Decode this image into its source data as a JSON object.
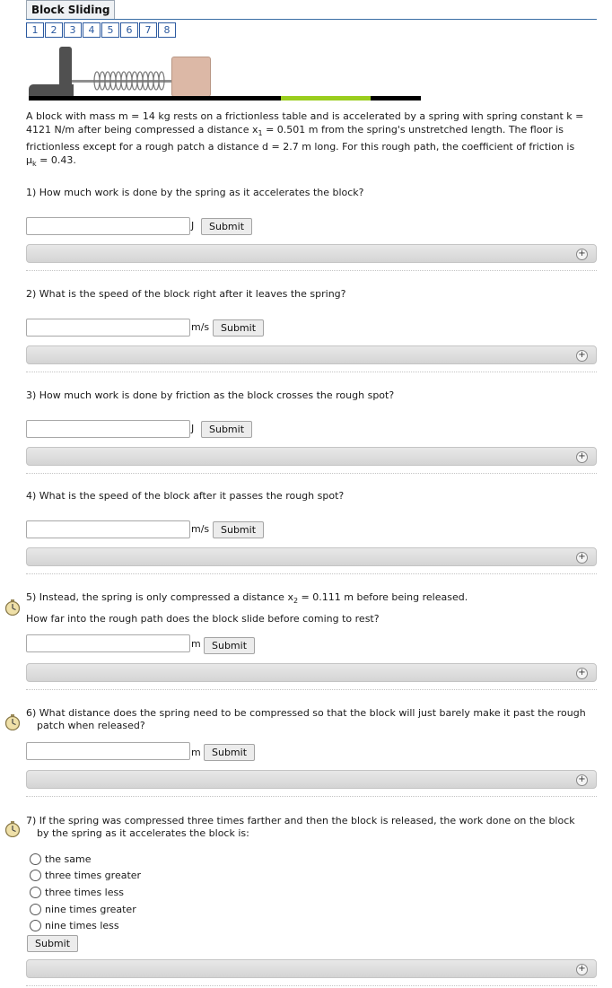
{
  "title": "Block Sliding",
  "pages": [
    "1",
    "2",
    "3",
    "4",
    "5",
    "6",
    "7",
    "8"
  ],
  "problem": {
    "line1": "A block with mass m = 14 kg rests on a frictionless table and is accelerated by a spring with spring constant k =",
    "line2_pre": "4121 N/m after being compressed a distance x",
    "line2_sub": "1",
    "line2_post": " = 0.501 m from the spring's unstretched length. The floor is",
    "line3": "frictionless except for a rough patch a distance d = 2.7 m long. For this rough path, the coefficient of friction is",
    "line4_pre": "μ",
    "line4_sub": "k",
    "line4_post": " = 0.43."
  },
  "questions": [
    {
      "text": "1) How much work is done by the spring as it accelerates the block?",
      "unit": "J",
      "submit": "Submit"
    },
    {
      "text": "2) What is the speed of the block right after it leaves the spring?",
      "unit": "m/s",
      "submit": "Submit"
    },
    {
      "text": "3) How much work is done by friction as the block crosses the rough spot?",
      "unit": "J",
      "submit": "Submit"
    },
    {
      "text": "4) What is the speed of the block after it passes the rough spot?",
      "unit": "m/s",
      "submit": "Submit"
    },
    {
      "text_pre": "5) Instead, the spring is only compressed a distance x",
      "text_sub": "2",
      "text_post": " = 0.111 m before being released.",
      "sub_text": "How far into the rough path does the block slide before coming to rest?",
      "unit": "m",
      "submit": "Submit"
    },
    {
      "text_l1": "6) What distance does the spring need to be compressed so that the block will just barely make it past the rough",
      "text_l2": "patch when released?",
      "unit": "m",
      "submit": "Submit"
    },
    {
      "text_l1": "7) If the spring was compressed three times farther and then the block is released, the work done on the block",
      "text_l2": "by the spring as it accelerates the block is:",
      "options": [
        "the same",
        "three times greater",
        "three times less",
        "nine times greater",
        "nine times less"
      ],
      "submit": "Submit"
    }
  ],
  "hint_icon": "plus-circle-icon",
  "timer_icon": "stopwatch-icon"
}
